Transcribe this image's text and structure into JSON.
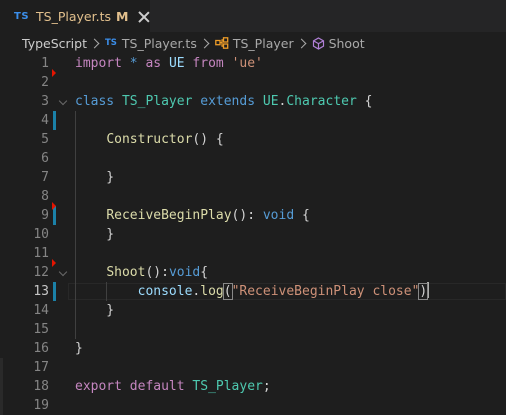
{
  "tab": {
    "icon": "TS",
    "title": "TS_Player.ts",
    "modified": "M",
    "close_icon": "close-icon"
  },
  "breadcrumb": {
    "items": [
      {
        "label": "TypeScript",
        "icon": ""
      },
      {
        "label": "TS_Player.ts",
        "icon": "TS"
      },
      {
        "label": "TS_Player",
        "icon": "class-icon"
      },
      {
        "label": "Shoot",
        "icon": "method-icon"
      }
    ]
  },
  "colors": {
    "keyword": "#569cd6",
    "control": "#c586c0",
    "string": "#ce9178",
    "type": "#4ec9b0",
    "function": "#dcdcaa",
    "variable": "#9cdcfe",
    "git_modified": "#1b81a8",
    "git_deleted": "#e51400"
  },
  "editor": {
    "active_line": "13",
    "lines": [
      {
        "n": "1",
        "t": [
          [
            "kw2",
            "import"
          ],
          [
            "pl",
            " "
          ],
          [
            "kw",
            "*"
          ],
          [
            "pl",
            " "
          ],
          [
            "kw2",
            "as"
          ],
          [
            "pl",
            " "
          ],
          [
            "var",
            "UE"
          ],
          [
            "pl",
            " "
          ],
          [
            "kw2",
            "from"
          ],
          [
            "pl",
            " "
          ],
          [
            "str",
            "'ue'"
          ]
        ]
      },
      {
        "n": "2",
        "t": []
      },
      {
        "n": "3",
        "t": [
          [
            "kw",
            "class"
          ],
          [
            "pl",
            " "
          ],
          [
            "ty",
            "TS_Player"
          ],
          [
            "pl",
            " "
          ],
          [
            "kw",
            "extends"
          ],
          [
            "pl",
            " "
          ],
          [
            "ty",
            "UE"
          ],
          [
            "pl",
            "."
          ],
          [
            "ty",
            "Character"
          ],
          [
            "pl",
            " {"
          ]
        ]
      },
      {
        "n": "4",
        "t": []
      },
      {
        "n": "5",
        "t": [
          [
            "pl",
            "    "
          ],
          [
            "fn",
            "Constructor"
          ],
          [
            "pl",
            "() {"
          ]
        ]
      },
      {
        "n": "6",
        "t": []
      },
      {
        "n": "7",
        "t": [
          [
            "pl",
            "    }"
          ]
        ]
      },
      {
        "n": "8",
        "t": []
      },
      {
        "n": "9",
        "t": [
          [
            "pl",
            "    "
          ],
          [
            "fn",
            "ReceiveBeginPlay"
          ],
          [
            "pl",
            "(): "
          ],
          [
            "kw",
            "void"
          ],
          [
            "pl",
            " {"
          ]
        ]
      },
      {
        "n": "10",
        "t": [
          [
            "pl",
            "    }"
          ]
        ]
      },
      {
        "n": "11",
        "t": []
      },
      {
        "n": "12",
        "t": [
          [
            "pl",
            "    "
          ],
          [
            "fn",
            "Shoot"
          ],
          [
            "pl",
            "():"
          ],
          [
            "kw",
            "void"
          ],
          [
            "pl",
            "{"
          ]
        ]
      },
      {
        "n": "13",
        "t": [
          [
            "pl",
            "        "
          ],
          [
            "var",
            "console"
          ],
          [
            "pl",
            "."
          ],
          [
            "fn",
            "log"
          ],
          [
            "bh",
            "("
          ],
          [
            "str",
            "\"ReceiveBeginPlay close\""
          ],
          [
            "bh",
            ")"
          ],
          [
            "cur",
            ""
          ]
        ]
      },
      {
        "n": "14",
        "t": [
          [
            "pl",
            "    }"
          ]
        ]
      },
      {
        "n": "15",
        "t": []
      },
      {
        "n": "16",
        "t": [
          [
            "pl",
            "}"
          ]
        ]
      },
      {
        "n": "17",
        "t": []
      },
      {
        "n": "18",
        "t": [
          [
            "kw2",
            "export"
          ],
          [
            "pl",
            " "
          ],
          [
            "kw2",
            "default"
          ],
          [
            "pl",
            " "
          ],
          [
            "ty",
            "TS_Player"
          ],
          [
            "pl",
            ";"
          ]
        ]
      },
      {
        "n": "19",
        "t": []
      }
    ]
  }
}
